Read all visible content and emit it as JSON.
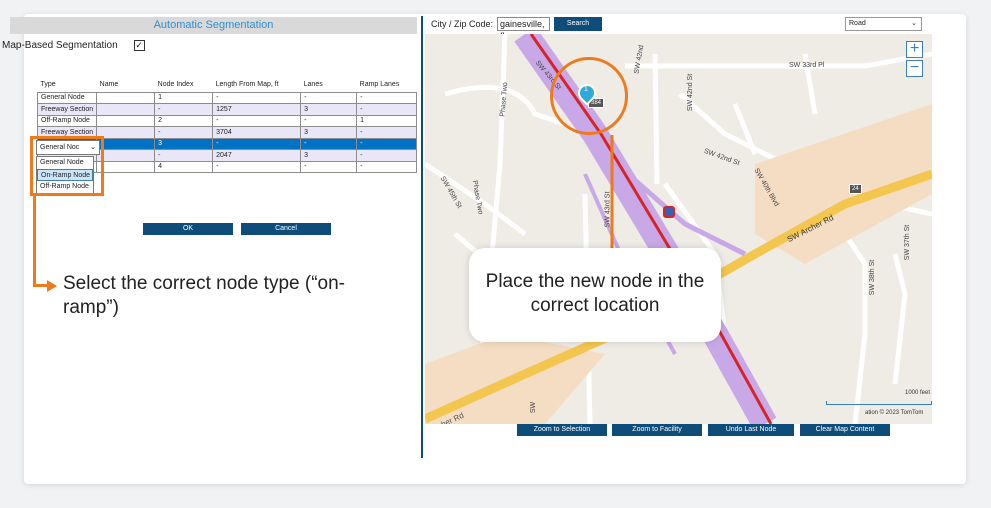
{
  "left_panel": {
    "header": "Automatic Segmentation",
    "map_based_label": "Map-Based Segmentation",
    "map_based_checked": "✓",
    "table": {
      "headers": [
        "Type",
        "Name",
        "Node Index",
        "Length From Map, ft",
        "Lanes",
        "Ramp Lanes"
      ],
      "rows": [
        [
          "General Node",
          "",
          "1",
          "-",
          "-",
          "-"
        ],
        [
          "Freeway Section",
          "",
          "-",
          "1257",
          "3",
          "-"
        ],
        [
          "Off-Ramp Node",
          "",
          "2",
          "-",
          "-",
          "1"
        ],
        [
          "Freeway Section",
          "",
          "-",
          "3704",
          "3",
          "-"
        ],
        [
          "",
          "",
          "3",
          "-",
          "-",
          "-"
        ],
        [
          "",
          "",
          "-",
          "2047",
          "3",
          "-"
        ],
        [
          "",
          "",
          "4",
          "-",
          "-",
          "-"
        ]
      ]
    },
    "combo_value": "General Noc",
    "combo_chevron": "⌄",
    "dropdown_options": [
      "General Node",
      "On-Ramp Node",
      "Off-Ramp Node"
    ],
    "ok_label": "OK",
    "cancel_label": "Cancel",
    "instruction": "Select the correct node type (“on-ramp”)"
  },
  "right_panel": {
    "city_label": "City / Zip Code:",
    "city_value": "gainesville, fl",
    "search_label": "Search",
    "map_style": "Road",
    "map_style_chevron": "⌄",
    "zoom_in": "+",
    "zoom_out": "−",
    "instruction": "Place the new node in the correct location",
    "scale_text": "1000 feet",
    "copyright": "ation   © 2023 TomTom",
    "buttons": [
      "Zoom to Selection",
      "Zoom to Facility",
      "Undo Last Node",
      "Clear Map Content"
    ],
    "map_labels": {
      "sw33rd": "SW 33rd Pl",
      "sw42nd_st": "SW 42nd St",
      "sw42nd_st2": "SW 42nd St",
      "sw43rd": "SW 43rd St",
      "sw43rd2": "SW 43rd St",
      "sw42nd": "SW 42nd",
      "phase_two": "Phase Two",
      "phase_two2": "Phase Two",
      "sw45th": "SW 45th St",
      "sw40th": "SW 40th Blvd",
      "archer": "SW Archer Rd",
      "sw38th": "SW 38th St",
      "sw37th": "SW 37th St",
      "archer_rd_bottom": "Archer Rd",
      "sw_bottom": "SW",
      "shield_384": "384",
      "shield_24": "24",
      "pin_number": "1"
    }
  },
  "colors": {
    "accent_orange": "#ee7a1e",
    "button_blue": "#0e4d7a",
    "header_text": "#2e8fd0",
    "selected_row": "#0072c6",
    "highway_purple": "#b48ad8",
    "highway_red": "#d8232a",
    "archer_yellow": "#f3c64f"
  }
}
